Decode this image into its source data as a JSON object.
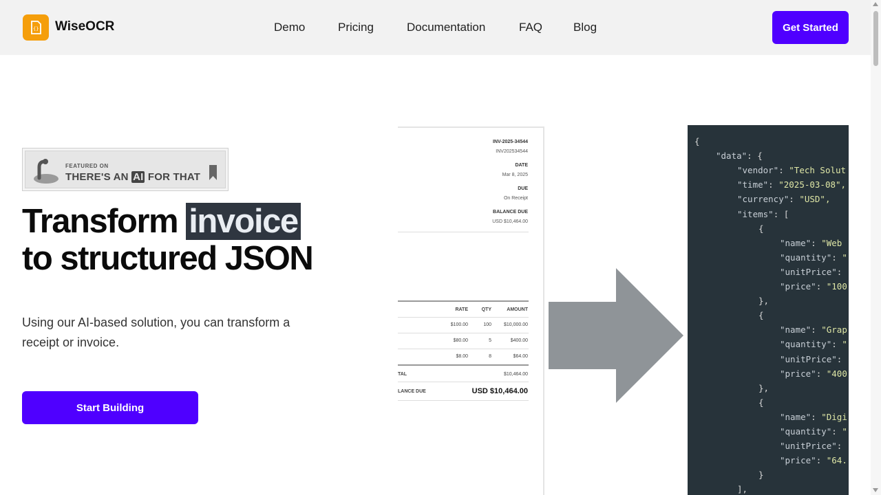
{
  "header": {
    "brand": "WiseOCR",
    "nav": [
      "Demo",
      "Pricing",
      "Documentation",
      "FAQ",
      "Blog"
    ],
    "cta_label": "Get Started"
  },
  "badge": {
    "featured": "FEATURED ON",
    "main_before": "THERE'S AN",
    "main_ai": "AI",
    "main_after": "FOR THAT"
  },
  "hero": {
    "title_line1_a": "Transform",
    "title_line1_highlight": "invoice",
    "title_line2": "to structured JSON",
    "subtitle": "Using our AI-based solution, you can transform a receipt or invoice.",
    "button_label": "Start Building"
  },
  "invoice": {
    "number_label": "INV-2025-34544",
    "number_value": "INV202534544",
    "date_label": "DATE",
    "date_value": "Mar 8, 2025",
    "due_label": "DUE",
    "due_value": "On Receipt",
    "balance_label": "BALANCE DUE",
    "balance_value": "USD $10,464.00",
    "columns": [
      "RATE",
      "QTY",
      "AMOUNT"
    ],
    "rows": [
      {
        "rate": "$100.00",
        "qty": "100",
        "amount": "$10,000.00"
      },
      {
        "rate": "$80.00",
        "qty": "5",
        "amount": "$400.00"
      },
      {
        "rate": "$8.00",
        "qty": "8",
        "amount": "$64.00"
      }
    ],
    "total_label": "TAL",
    "total_value": "$10,464.00",
    "balance_due_label": "LANCE DUE",
    "balance_due_value": "USD $10,464.00"
  },
  "json_preview": {
    "lines": [
      {
        "indent": 0,
        "key": "",
        "val": "{"
      },
      {
        "indent": 1,
        "key": "\"data\"",
        "val": ": {"
      },
      {
        "indent": 2,
        "key": "\"vendor\"",
        "val": ": ",
        "str": "\"Tech Solut"
      },
      {
        "indent": 2,
        "key": "\"time\"",
        "val": ": ",
        "str": "\"2025-03-08\","
      },
      {
        "indent": 2,
        "key": "\"currency\"",
        "val": ": ",
        "str": "\"USD\","
      },
      {
        "indent": 2,
        "key": "\"items\"",
        "val": ": ["
      },
      {
        "indent": 3,
        "key": "",
        "val": "{"
      },
      {
        "indent": 4,
        "key": "\"name\"",
        "val": ": ",
        "str": "\"Web"
      },
      {
        "indent": 4,
        "key": "\"quantity\"",
        "val": ": ",
        "str": "\""
      },
      {
        "indent": 4,
        "key": "\"unitPrice\"",
        "val": ":"
      },
      {
        "indent": 4,
        "key": "\"price\"",
        "val": ": ",
        "str": "\"100"
      },
      {
        "indent": 3,
        "key": "",
        "val": "},"
      },
      {
        "indent": 3,
        "key": "",
        "val": "{"
      },
      {
        "indent": 4,
        "key": "\"name\"",
        "val": ": ",
        "str": "\"Grap"
      },
      {
        "indent": 4,
        "key": "\"quantity\"",
        "val": ": ",
        "str": "\""
      },
      {
        "indent": 4,
        "key": "\"unitPrice\"",
        "val": ":"
      },
      {
        "indent": 4,
        "key": "\"price\"",
        "val": ": ",
        "str": "\"400"
      },
      {
        "indent": 3,
        "key": "",
        "val": "},"
      },
      {
        "indent": 3,
        "key": "",
        "val": "{"
      },
      {
        "indent": 4,
        "key": "\"name\"",
        "val": ": ",
        "str": "\"Digi"
      },
      {
        "indent": 4,
        "key": "\"quantity\"",
        "val": ": ",
        "str": "\""
      },
      {
        "indent": 4,
        "key": "\"unitPrice\"",
        "val": ":"
      },
      {
        "indent": 4,
        "key": "\"price\"",
        "val": ": ",
        "str": "\"64."
      },
      {
        "indent": 3,
        "key": "",
        "val": "}"
      },
      {
        "indent": 2,
        "key": "",
        "val": "],"
      }
    ]
  },
  "colors": {
    "accent": "#4f00ff",
    "logo": "#f59e0b",
    "json_bg": "#27333a",
    "arrow": "#8f9498"
  }
}
